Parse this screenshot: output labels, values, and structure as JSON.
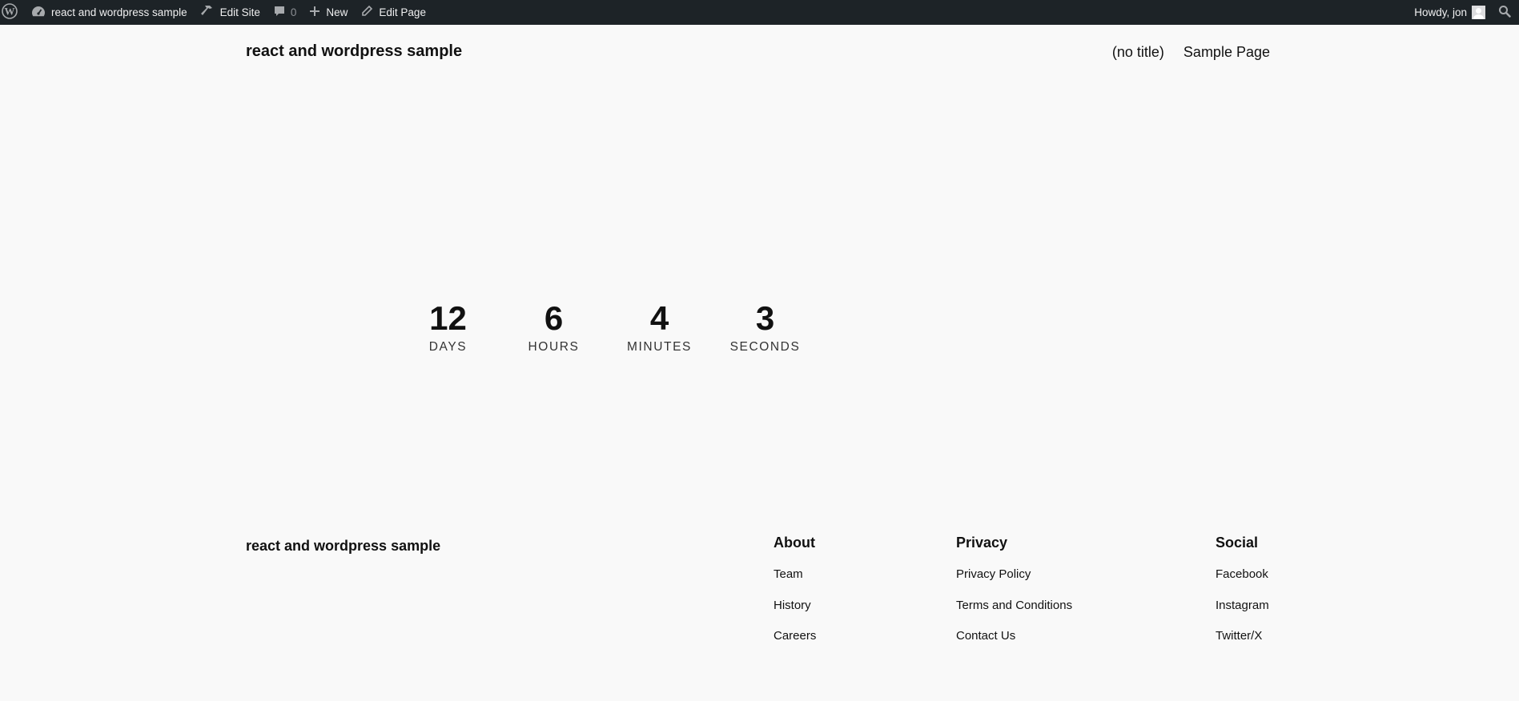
{
  "admin_bar": {
    "site_name": "react and wordpress sample",
    "edit_site": "Edit Site",
    "comments_count": "0",
    "new_label": "New",
    "edit_page": "Edit Page",
    "howdy": "Howdy, jon",
    "icons": [
      "wordpress-icon",
      "dashboard-icon",
      "hammer-icon",
      "comment-icon",
      "plus-icon",
      "pencil-icon",
      "avatar",
      "search-icon"
    ]
  },
  "header": {
    "site_title": "react and wordpress sample",
    "nav": [
      "(no title)",
      "Sample Page"
    ]
  },
  "countdown": [
    {
      "value": "12",
      "label": "DAYS"
    },
    {
      "value": "6",
      "label": "HOURS"
    },
    {
      "value": "4",
      "label": "MINUTES"
    },
    {
      "value": "3",
      "label": "SECONDS"
    }
  ],
  "footer": {
    "site_title": "react and wordpress sample",
    "columns": [
      {
        "heading": "About",
        "links": [
          "Team",
          "History",
          "Careers"
        ]
      },
      {
        "heading": "Privacy",
        "links": [
          "Privacy Policy",
          "Terms and Conditions",
          "Contact Us"
        ]
      },
      {
        "heading": "Social",
        "links": [
          "Facebook",
          "Instagram",
          "Twitter/X"
        ]
      }
    ]
  },
  "colors": {
    "admin_bar_bg": "#1d2327",
    "page_bg": "#f9f9f9",
    "text": "#111111"
  }
}
